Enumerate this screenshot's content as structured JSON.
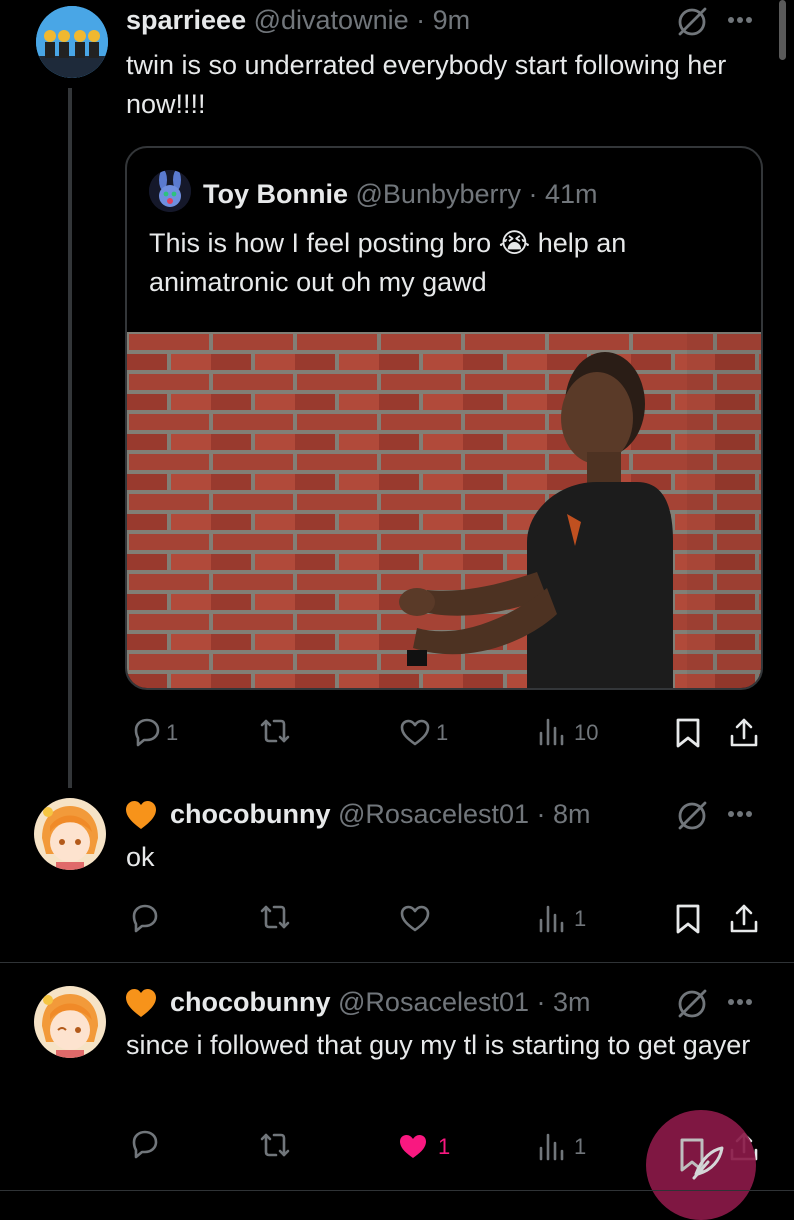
{
  "posts": [
    {
      "display_name": "sparrieee",
      "handle": "@divatownie",
      "time": "· 9m",
      "text": "twin is so underrated everybody start following her now!!!!",
      "quote": {
        "display_name": "Toy Bonnie",
        "handle": "@Bunbyberry",
        "time": "· 41m",
        "text": "This is how I feel posting bro 😭 help an animatronic out oh my gawd",
        "media": "man-talking-to-brick-wall"
      },
      "actions": {
        "replies": "1",
        "reposts": "",
        "likes": "1",
        "views": "10"
      }
    },
    {
      "display_name": "chocobunny",
      "handle": "@Rosacelest01",
      "time": "· 8m",
      "text": "ok",
      "actions": {
        "replies": "",
        "reposts": "",
        "likes": "",
        "views": "1"
      }
    },
    {
      "display_name": "chocobunny",
      "handle": "@Rosacelest01",
      "time": "· 3m",
      "text": "since i followed that guy my tl is starting to get gayer",
      "actions": {
        "replies": "",
        "reposts": "",
        "likes": "1",
        "views": "1",
        "liked": true
      }
    }
  ],
  "icons": {
    "reply": "speech-bubble-icon",
    "repost": "repost-arrows-icon",
    "like": "heart-icon",
    "views": "bar-chart-icon",
    "bookmark": "bookmark-icon",
    "share": "share-upload-icon",
    "more": "ellipsis-icon",
    "grok": "slashed-circle-icon",
    "badge": "orange-heart-icon",
    "fab": "feather-compose-icon"
  },
  "colors": {
    "background": "#000000",
    "text": "#e7e9ea",
    "muted": "#71767b",
    "like_active": "#f91880",
    "badge": "#f7931a",
    "fab": "#8a1a48"
  }
}
